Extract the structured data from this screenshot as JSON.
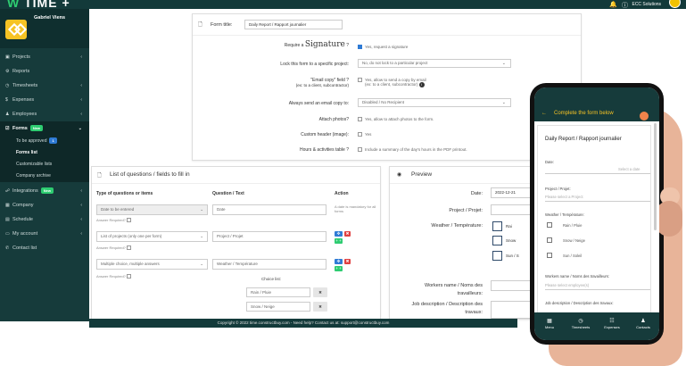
{
  "app": {
    "brand_prefix": "W",
    "brand_name": "TIME +",
    "user_label": "ECC Solutions",
    "bell_icon": "bell-icon",
    "info_icon": "info-icon"
  },
  "sidebar": {
    "user_name": "Gabriel Viens",
    "items": [
      {
        "label": "Projects",
        "icon": "briefcase-icon"
      },
      {
        "label": "Reports",
        "icon": "chart-icon"
      },
      {
        "label": "Timesheets",
        "icon": "clock-icon"
      },
      {
        "label": "Expenses",
        "icon": "dollar-icon"
      },
      {
        "label": "Employees",
        "icon": "users-icon"
      },
      {
        "label": "Forms",
        "icon": "checkbox-icon",
        "badge": "New"
      },
      {
        "label": "Integrations",
        "icon": "plug-icon",
        "badge": "New"
      },
      {
        "label": "Company",
        "icon": "building-icon"
      },
      {
        "label": "Schedule",
        "icon": "calendar-icon"
      },
      {
        "label": "My account",
        "icon": "card-icon"
      },
      {
        "label": "Contact list",
        "icon": "phone-icon"
      }
    ],
    "forms_sub": [
      {
        "label": "To be approved",
        "badge": "1"
      },
      {
        "label": "Forms list"
      },
      {
        "label": "Customizable lists"
      },
      {
        "label": "Company archive"
      }
    ]
  },
  "settings": {
    "form_title_label": "Form title:",
    "form_title_value": "Daily Report / Rapport journalier",
    "require_pre": "Require a",
    "require_sig": "Signature",
    "require_q": "?",
    "require_val": "Yes, request a signature",
    "lock_label": "Lock this form to a specific project:",
    "lock_val": "No, do not lock to a particular project",
    "email_label": "\"Email copy\" field ?",
    "email_sub": "(ex: to a client, subcontractor)",
    "email_val": "Yes, allow to send a copy by email",
    "email_val2": "(ex: to a client, subcontractor)",
    "always_label": "Always send an email copy to:",
    "always_val": "Disabled / No Recipient",
    "photos_label": "Attach photos?",
    "photos_val": "Yes, allow to attach photos to the form.",
    "header_label": "Custom header (image):",
    "header_val": "Yes",
    "hours_label": "Hours & activities table ?",
    "hours_val": "Include a summary of the day's hours in the PDF printout."
  },
  "questions": {
    "title": "List of questions / fields to fill in",
    "col_type": "Type of questions or items",
    "col_text": "Question / Text",
    "col_action": "Action",
    "answer_required": "Answer Required?",
    "rows": [
      {
        "type": "Date to be entered",
        "text": "Date",
        "note": "A date is mandatory for all forms"
      },
      {
        "type": "List of projects (only one per form)",
        "text": "Project / Projet"
      },
      {
        "type": "Multiple choice, multiple answers",
        "text": "Weather / Température",
        "choice_list": "Choice list:",
        "choices": [
          "Rain / Pluie",
          "Snow / Neige"
        ]
      }
    ]
  },
  "preview": {
    "title": "Preview",
    "date_label": "Date:",
    "date_val": "2022-12-21",
    "project_label": "Project / Projet:",
    "weather_label": "Weather / Température:",
    "weather_opts": [
      "Rai",
      "Snow",
      "Sun / S"
    ],
    "workers_label": "Workers name / Noms des travailleurs:",
    "job_label": "Job description / Description des travaux:"
  },
  "footer": {
    "text": "Copyright © 2022 time.constructbuy.com - Need help? Contact us at: support@constructbuy.com"
  },
  "phone": {
    "header": "Complete the form below",
    "form_title": "Daily Report / Rapport journalier",
    "date_label": "Date:",
    "date_placeholder": "Select a date",
    "project_label": "Project / Projet:",
    "project_placeholder": "Please select a Project",
    "weather_label": "Weather / Température:",
    "weather_opts": [
      "Rain / Pluie",
      "Snow / Neige",
      "Sun / Soleil"
    ],
    "workers_label": "Workers name / Noms des travailleurs:",
    "workers_placeholder": "Please select employee(s)",
    "job_label": "Job description / Description des travaux:",
    "nav": [
      {
        "label": "Menu",
        "icon": "grid-icon"
      },
      {
        "label": "Timesheets",
        "icon": "clock-icon"
      },
      {
        "label": "Expenses",
        "icon": "cart-icon"
      },
      {
        "label": "Contacts",
        "icon": "person-icon"
      }
    ]
  }
}
